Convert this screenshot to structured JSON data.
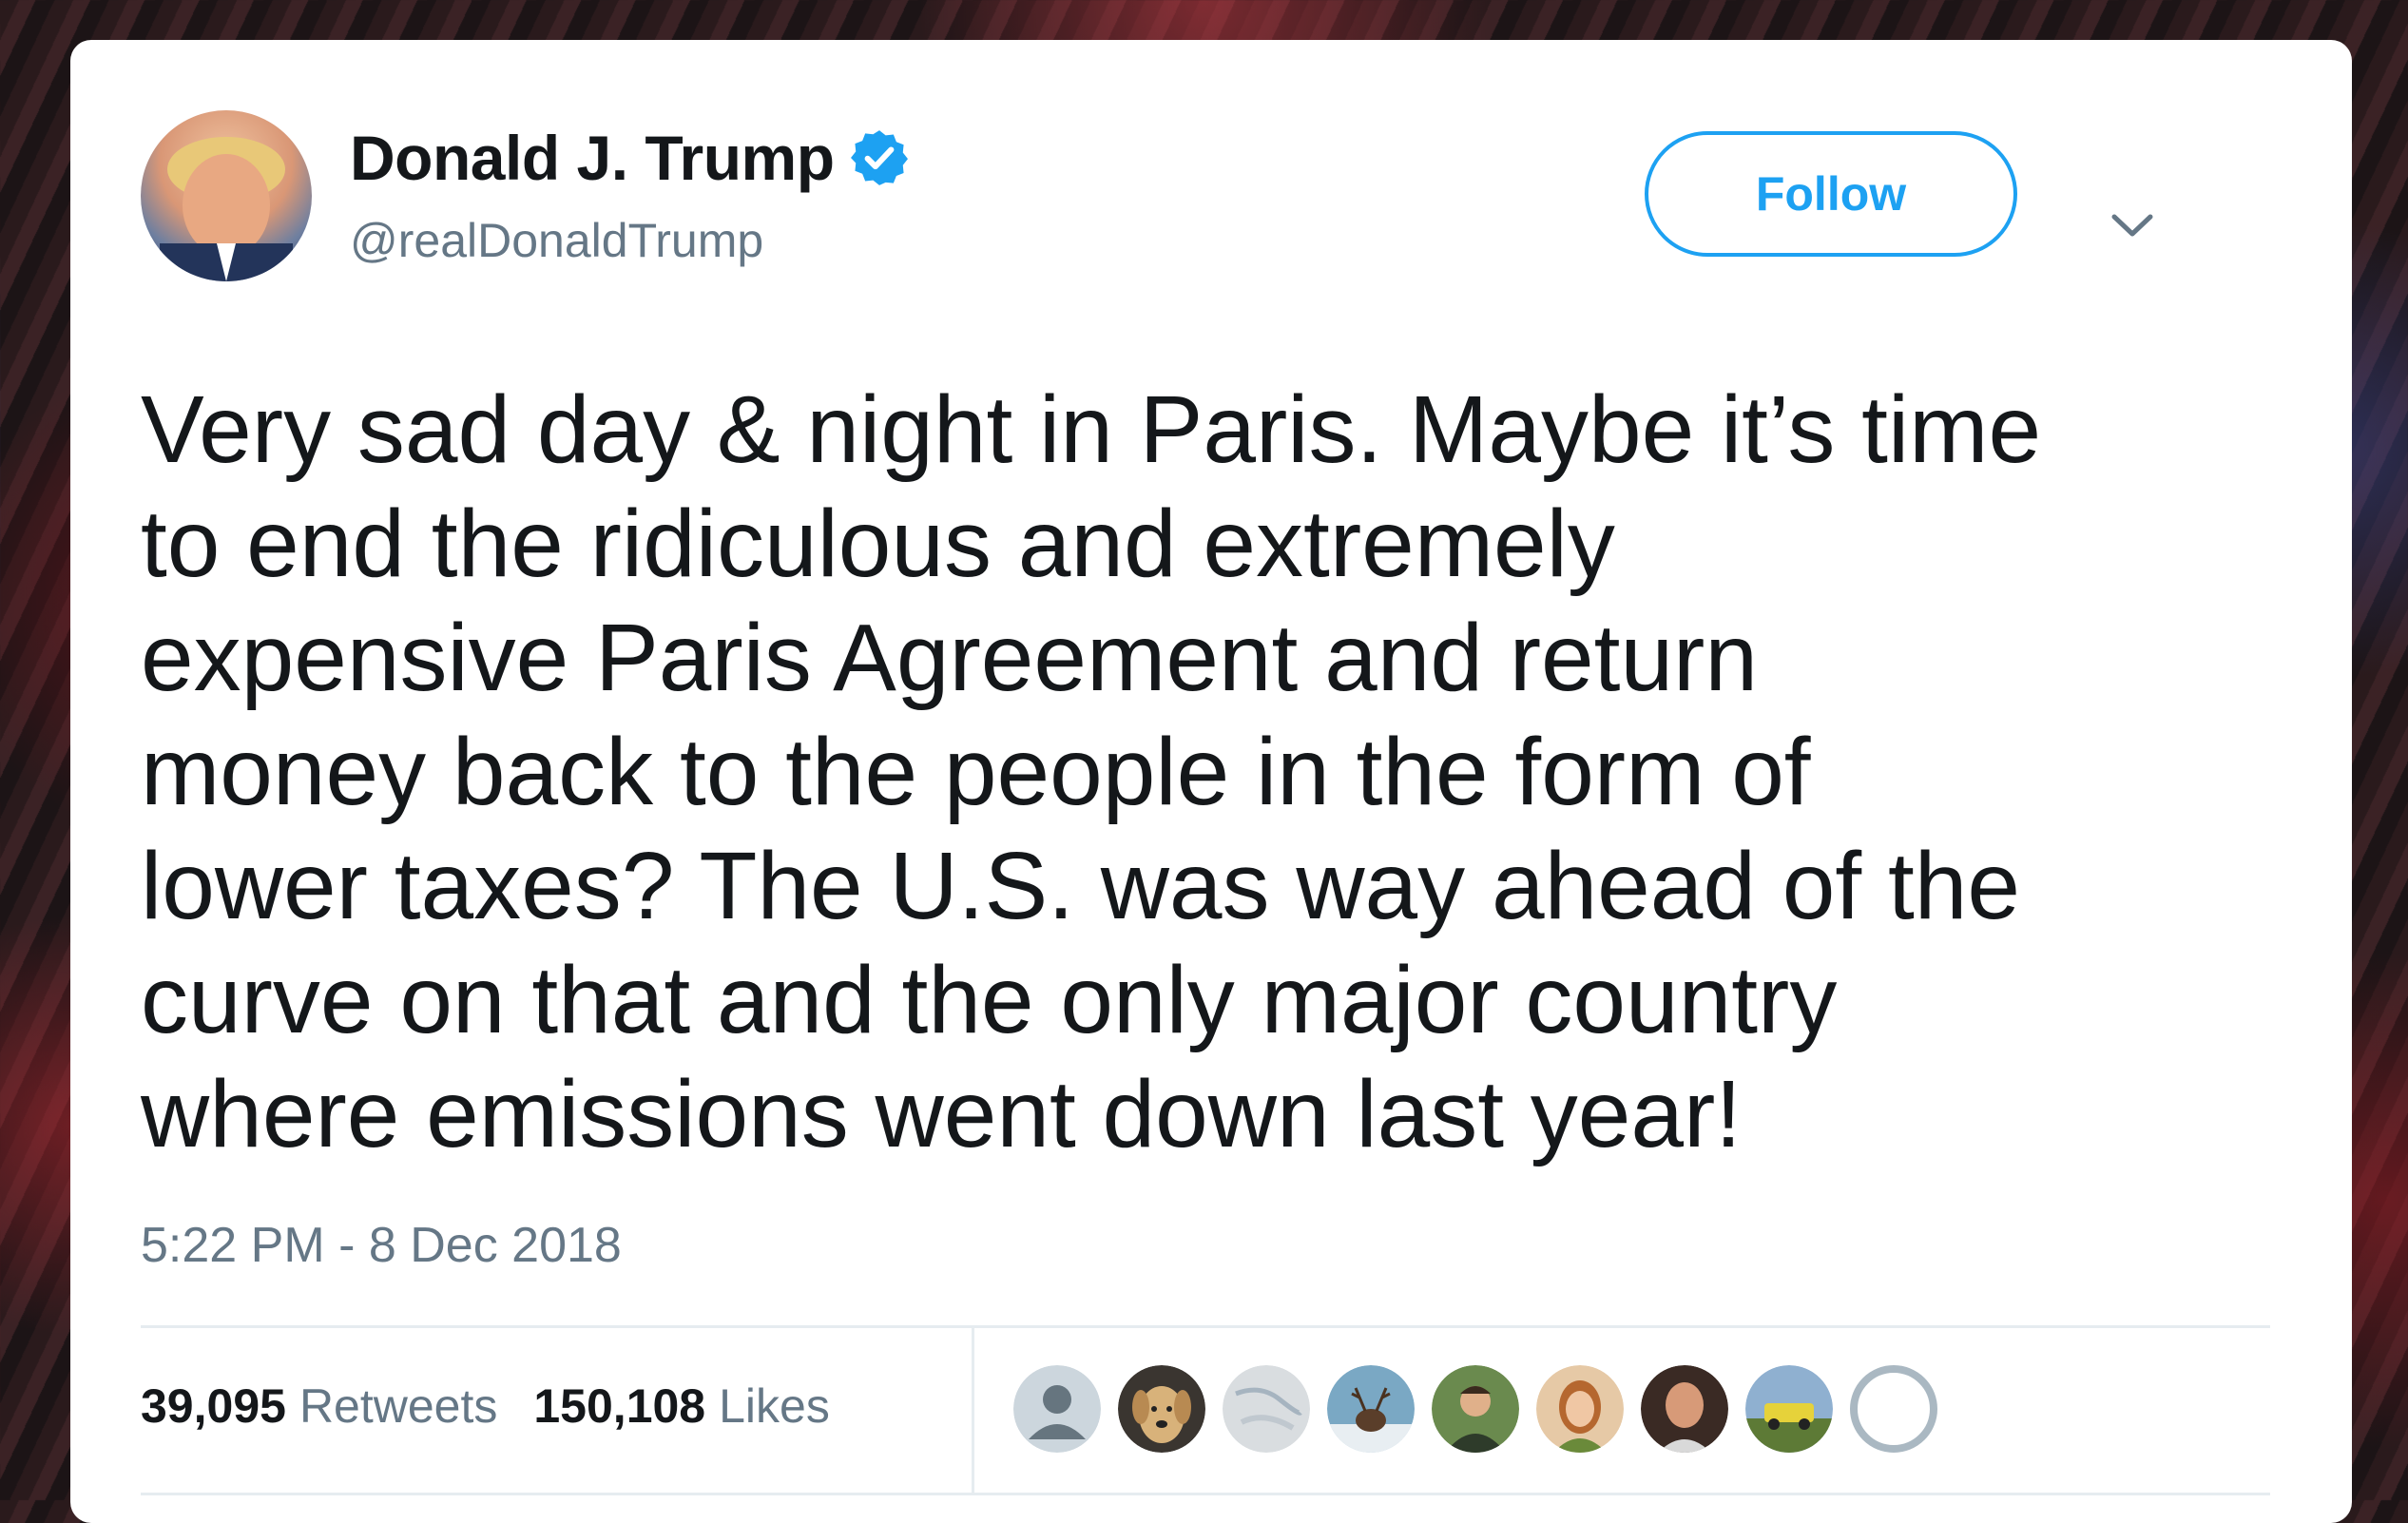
{
  "tweet": {
    "author": {
      "name": "Donald J. Trump",
      "handle": "@realDonaldTrump",
      "avatar_icon": "profile-photo",
      "verified_icon": "verified-badge-icon"
    },
    "follow_label": "Follow",
    "menu_icon": "chevron-down-icon",
    "text_lines": [
      "Very sad day & night in Paris. Maybe it’s time",
      "to end the ridiculous and extremely",
      "expensive Paris Agreement and return",
      "money back to the people in the form of",
      "lower taxes? The U.S. was way ahead of the",
      "curve on that and the only major country",
      "where emissions went down last year!"
    ],
    "timestamp": "5:22 PM - 8 Dec 2018",
    "stats": {
      "retweets_count": "39,095",
      "retweets_label": "Retweets",
      "likes_count": "150,108",
      "likes_label": "Likes"
    },
    "likers": [
      {
        "icon": "default-user-avatar",
        "color": "#aab8c2"
      },
      {
        "icon": "dog-photo-avatar",
        "color": "#c9a46a"
      },
      {
        "icon": "map-photo-avatar",
        "color": "#cfd3d6"
      },
      {
        "icon": "deer-photo-avatar",
        "color": "#4f7d9b"
      },
      {
        "icon": "man-photo-avatar",
        "color": "#5f7a4a"
      },
      {
        "icon": "woman-photo-avatar",
        "color": "#d8a07a"
      },
      {
        "icon": "bald-man-photo-avatar",
        "color": "#8a5a44"
      },
      {
        "icon": "car-photo-avatar",
        "color": "#7a8f3a"
      },
      {
        "icon": "more-likers-icon",
        "color": "#aab8c2"
      }
    ],
    "colors": {
      "accent": "#1da1f2",
      "text": "#14171a",
      "secondary_text": "#657786",
      "divider": "#e6ecf0"
    }
  }
}
